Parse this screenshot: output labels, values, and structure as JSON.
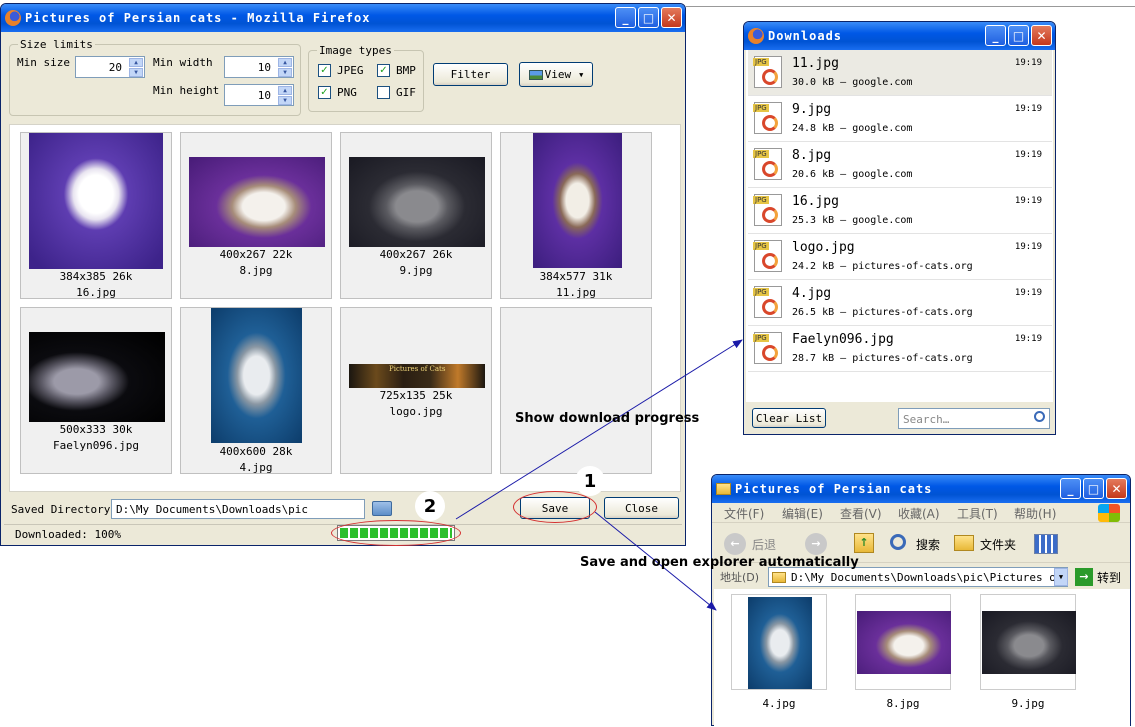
{
  "firefox_window": {
    "title": "Pictures of Persian cats - Mozilla Firefox",
    "size_limits_label": "Size limits",
    "min_size_label": "Min size",
    "min_size_value": "20",
    "min_width_label": "Min width",
    "min_width_value": "10",
    "min_height_label": "Min height",
    "min_height_value": "10",
    "image_types_label": "Image types",
    "types": [
      {
        "label": "JPEG",
        "checked": true
      },
      {
        "label": "BMP",
        "checked": true
      },
      {
        "label": "PNG",
        "checked": true
      },
      {
        "label": "GIF",
        "checked": false
      }
    ],
    "filter_label": "Filter",
    "view_label": "View",
    "images": [
      {
        "dims": "384x385 26k",
        "file": "16.jpg"
      },
      {
        "dims": "400x267 22k",
        "file": "8.jpg"
      },
      {
        "dims": "400x267 26k",
        "file": "9.jpg"
      },
      {
        "dims": "384x577 31k",
        "file": "11.jpg"
      },
      {
        "dims": "500x333 30k",
        "file": "Faelyn096.jpg"
      },
      {
        "dims": "400x600 28k",
        "file": "4.jpg"
      },
      {
        "dims": "725x135 25k",
        "file": "logo.jpg"
      }
    ],
    "logo_banner_text": "Pictures of Cats",
    "saved_dir_label": "Saved Directory",
    "saved_dir_value": "D:\\My Documents\\Downloads\\pic",
    "save_label": "Save",
    "close_label": "Close",
    "status_text": "Downloaded: 100%",
    "progress": 1.0
  },
  "downloads_window": {
    "title": "Downloads",
    "items": [
      {
        "name": "11.jpg",
        "info": "30.0 kB — google.com",
        "time": "19:19"
      },
      {
        "name": "9.jpg",
        "info": "24.8 kB — google.com",
        "time": "19:19"
      },
      {
        "name": "8.jpg",
        "info": "20.6 kB — google.com",
        "time": "19:19"
      },
      {
        "name": "16.jpg",
        "info": "25.3 kB — google.com",
        "time": "19:19"
      },
      {
        "name": "logo.jpg",
        "info": "24.2 kB — pictures-of-cats.org",
        "time": "19:19"
      },
      {
        "name": "4.jpg",
        "info": "26.5 kB — pictures-of-cats.org",
        "time": "19:19"
      },
      {
        "name": "Faelyn096.jpg",
        "info": "28.7 kB — pictures-of-cats.org",
        "time": "19:19"
      }
    ],
    "clear_label": "Clear List",
    "search_placeholder": "Search…"
  },
  "explorer_window": {
    "title": "Pictures of Persian cats",
    "menu": [
      "文件(F)",
      "编辑(E)",
      "查看(V)",
      "收藏(A)",
      "工具(T)",
      "帮助(H)"
    ],
    "back_label": "后退",
    "search_label": "搜索",
    "folders_label": "文件夹",
    "address_label": "地址(D)",
    "address_value": "D:\\My Documents\\Downloads\\pic\\Pictures of P",
    "go_label": "转到",
    "files": [
      "4.jpg",
      "8.jpg",
      "9.jpg"
    ]
  },
  "annotations": {
    "show_progress": "Show download progress",
    "save_open": "Save and open explorer automatically",
    "badge1": "1",
    "badge2": "2"
  },
  "colors": {
    "titlebar_blue": "#0058e6",
    "progress_green": "#2dbf2d",
    "annotation_line": "#1a1aa8",
    "highlight_ellipse": "#d43030"
  }
}
